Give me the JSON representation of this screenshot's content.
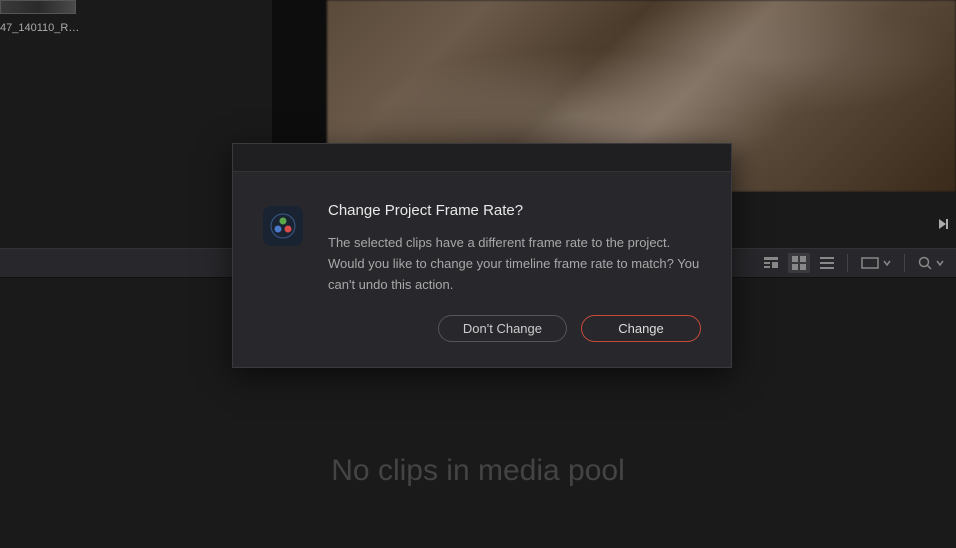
{
  "media_panel": {
    "clip_label": "47_140110_R6..."
  },
  "media_pool": {
    "empty_message": "No clips in media pool"
  },
  "dialog": {
    "title": "Change Project Frame Rate?",
    "message": "The selected clips have a different frame rate to the project. Would you like to change your timeline frame rate to match? You can't undo this action.",
    "buttons": {
      "cancel": "Don't Change",
      "confirm": "Change"
    }
  },
  "toolbar": {
    "view_modes": [
      "metadata",
      "grid",
      "list"
    ],
    "active_view": "grid"
  }
}
